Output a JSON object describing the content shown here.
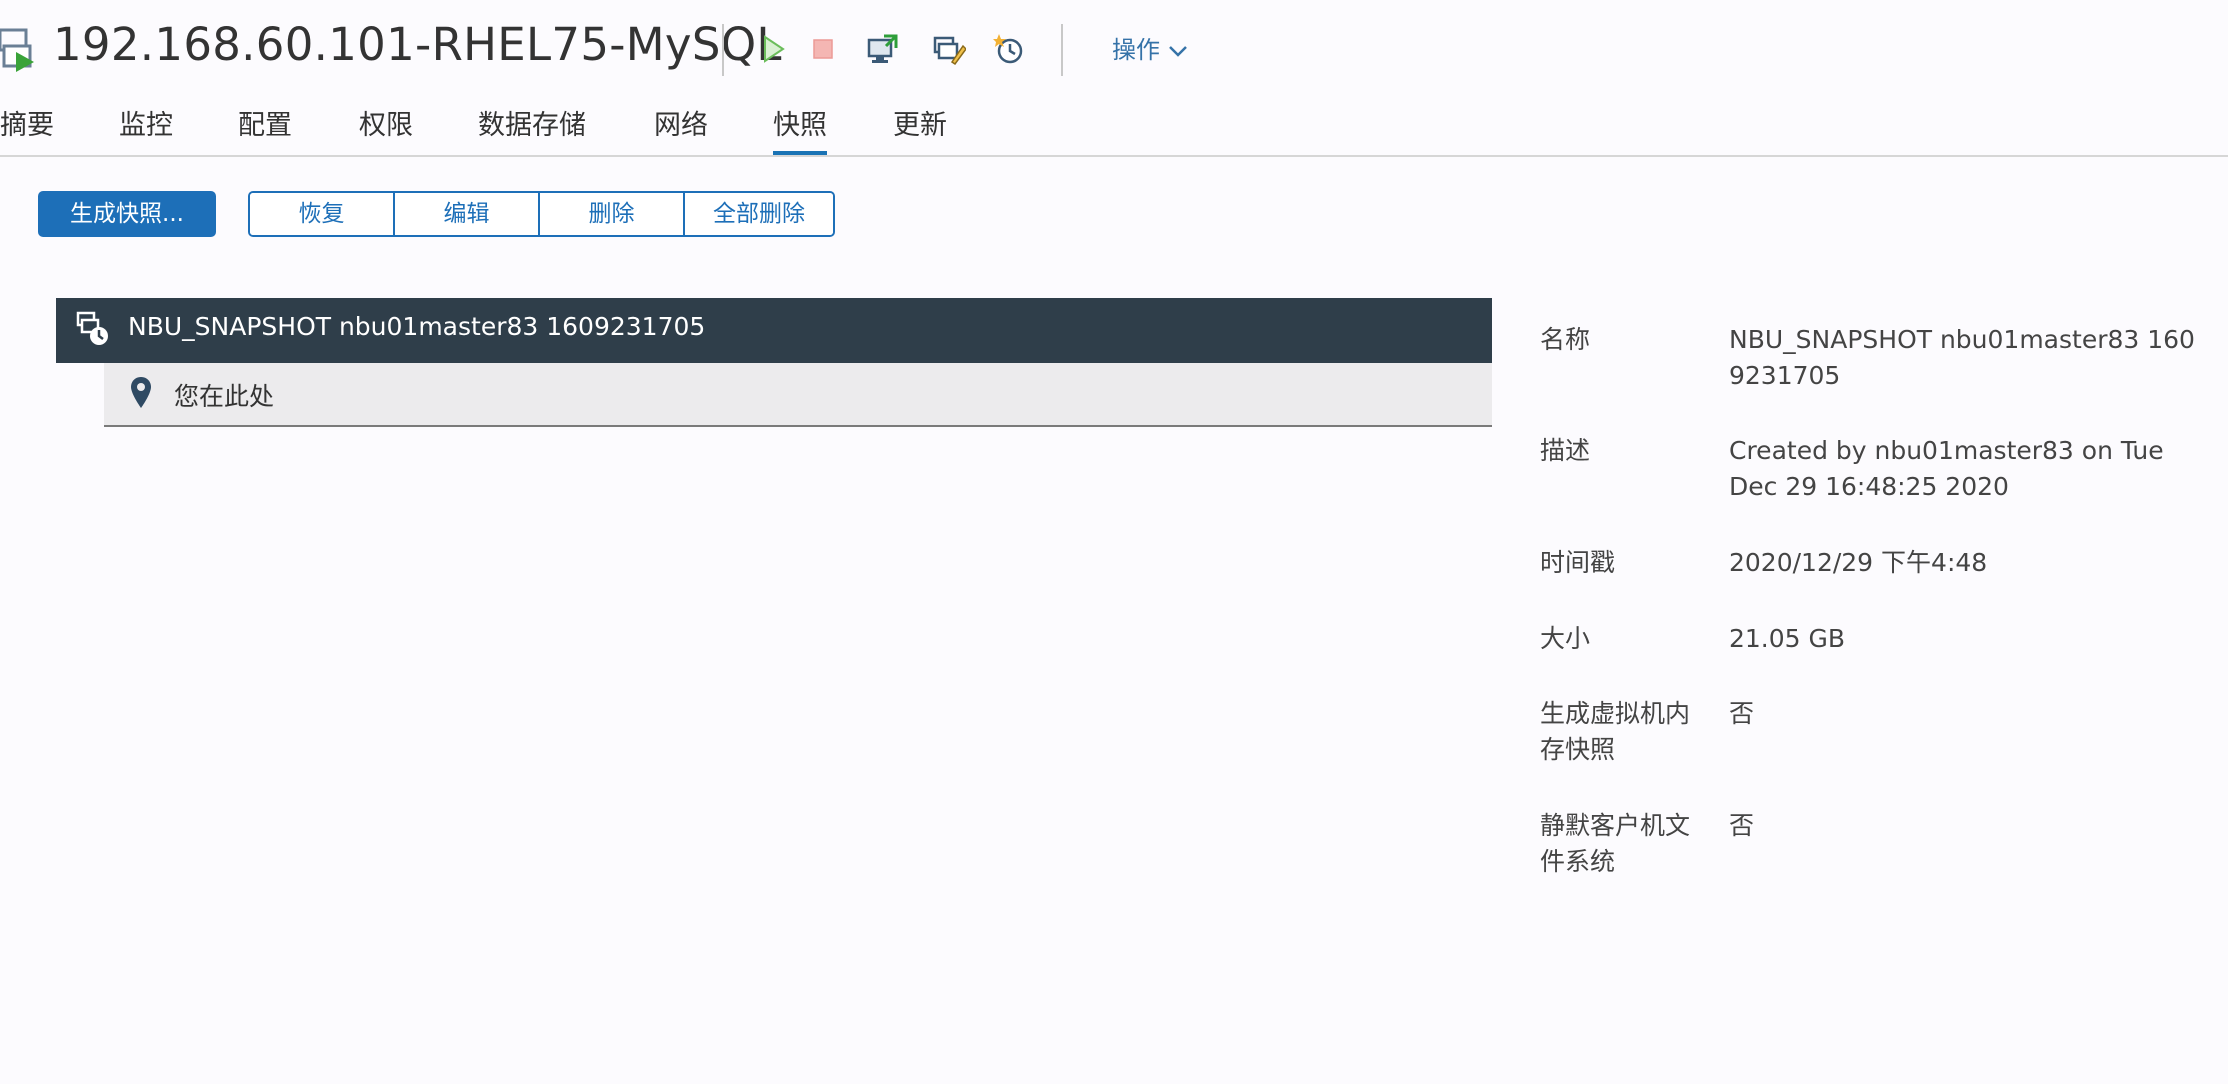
{
  "header": {
    "vm_name": "192.168.60.101-RHEL75-MySQL",
    "actions_label": "操作",
    "toolbar_icons": [
      "power-on-icon",
      "power-off-icon",
      "console-icon",
      "edit-settings-icon",
      "snapshot-icon"
    ]
  },
  "tabs": [
    {
      "label": "摘要",
      "active": false
    },
    {
      "label": "监控",
      "active": false
    },
    {
      "label": "配置",
      "active": false
    },
    {
      "label": "权限",
      "active": false
    },
    {
      "label": "数据存储",
      "active": false
    },
    {
      "label": "网络",
      "active": false
    },
    {
      "label": "快照",
      "active": true
    },
    {
      "label": "更新",
      "active": false
    }
  ],
  "buttons": {
    "take_snapshot": "生成快照...",
    "revert": "恢复",
    "edit": "编辑",
    "delete": "删除",
    "delete_all": "全部删除"
  },
  "tree": {
    "snapshot_name": "NBU_SNAPSHOT nbu01master83 1609231705",
    "you_are_here": "您在此处"
  },
  "details": [
    {
      "label": "名称",
      "value": "NBU_SNAPSHOT nbu01master83 1609231705"
    },
    {
      "label": "描述",
      "value": "Created by nbu01master83 on Tue Dec 29 16:48:25 2020"
    },
    {
      "label": "时间戳",
      "value": "2020/12/29 下午4:48"
    },
    {
      "label": "大小",
      "value": "21.05 GB"
    },
    {
      "label": "生成虚拟机内存快照",
      "value": "否"
    },
    {
      "label": "静默客户机文件系统",
      "value": "否"
    }
  ],
  "colors": {
    "accent": "#1d6fb8",
    "selected_row": "#2f3e4a",
    "tab_underline": "#1a73b5"
  }
}
